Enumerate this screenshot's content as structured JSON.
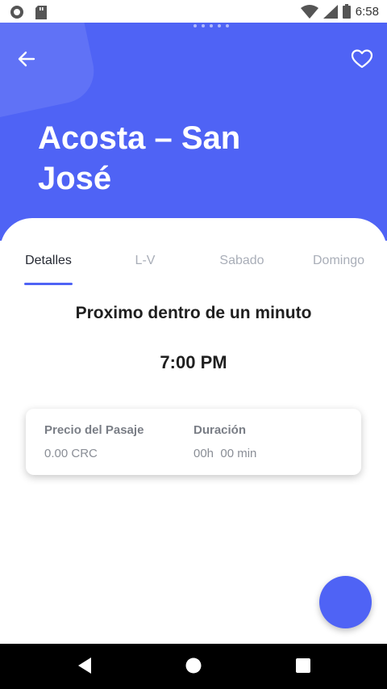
{
  "status_bar": {
    "time": "6:58"
  },
  "header": {
    "title": "Acosta – San José",
    "accent_color": "#4f63f5"
  },
  "tabs": [
    {
      "label": "Detalles",
      "active": true
    },
    {
      "label": "L-V",
      "active": false
    },
    {
      "label": "Sabado",
      "active": false
    },
    {
      "label": "Domingo",
      "active": false
    }
  ],
  "next": {
    "label": "Proximo dentro de un minuto",
    "time": "7:00 PM"
  },
  "card": {
    "price_label": "Precio del Pasaje",
    "price_value": "0.00 CRC",
    "duration_label": "Duración",
    "duration_value": "00h  00 min"
  },
  "icons": {
    "back": "arrow-left-icon",
    "favorite": "heart-outline-icon",
    "nav_back": "triangle-back-icon",
    "nav_home": "circle-home-icon",
    "nav_recents": "square-recents-icon"
  }
}
